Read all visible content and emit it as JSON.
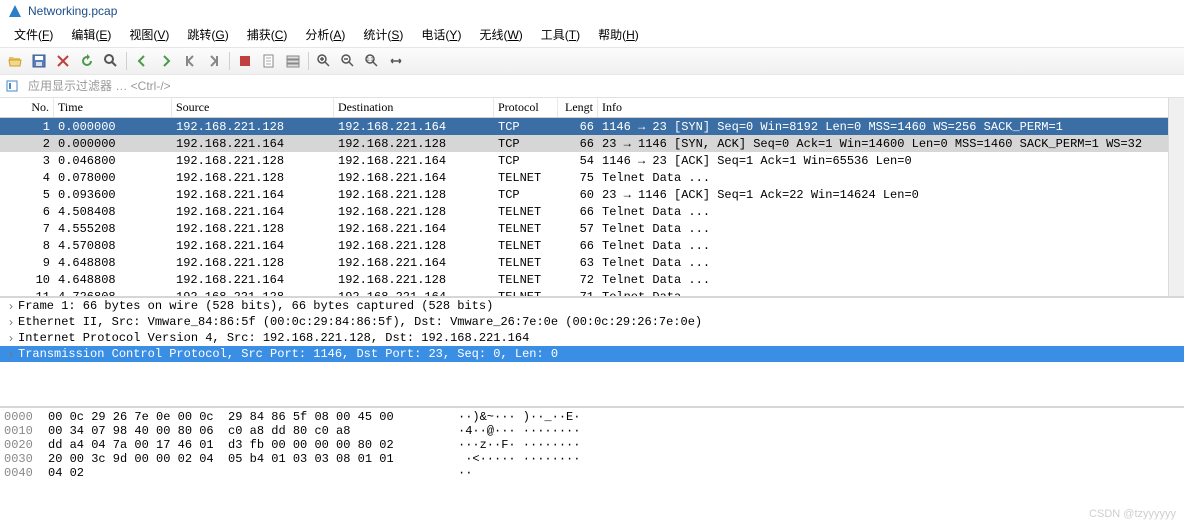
{
  "title": "Networking.pcap",
  "menu": [
    "文件(F)",
    "编辑(E)",
    "视图(V)",
    "跳转(G)",
    "捕获(C)",
    "分析(A)",
    "统计(S)",
    "电话(Y)",
    "无线(W)",
    "工具(T)",
    "帮助(H)"
  ],
  "filter_placeholder": "应用显示过滤器 … <Ctrl-/>",
  "columns": {
    "no": "No.",
    "time": "Time",
    "src": "Source",
    "dst": "Destination",
    "proto": "Protocol",
    "len": "Lengt",
    "info": "Info"
  },
  "packets": [
    {
      "no": "1",
      "time": "0.000000",
      "src": "192.168.221.128",
      "dst": "192.168.221.164",
      "proto": "TCP",
      "len": "66",
      "info": "1146 → 23 [SYN] Seq=0 Win=8192 Len=0 MSS=1460 WS=256 SACK_PERM=1",
      "sel": true
    },
    {
      "no": "2",
      "time": "0.000000",
      "src": "192.168.221.164",
      "dst": "192.168.221.128",
      "proto": "TCP",
      "len": "66",
      "info": "23 → 1146 [SYN, ACK] Seq=0 Ack=1 Win=14600 Len=0 MSS=1460 SACK_PERM=1 WS=32",
      "hl": true
    },
    {
      "no": "3",
      "time": "0.046800",
      "src": "192.168.221.128",
      "dst": "192.168.221.164",
      "proto": "TCP",
      "len": "54",
      "info": "1146 → 23 [ACK] Seq=1 Ack=1 Win=65536 Len=0"
    },
    {
      "no": "4",
      "time": "0.078000",
      "src": "192.168.221.128",
      "dst": "192.168.221.164",
      "proto": "TELNET",
      "len": "75",
      "info": "Telnet Data ..."
    },
    {
      "no": "5",
      "time": "0.093600",
      "src": "192.168.221.164",
      "dst": "192.168.221.128",
      "proto": "TCP",
      "len": "60",
      "info": "23 → 1146 [ACK] Seq=1 Ack=22 Win=14624 Len=0"
    },
    {
      "no": "6",
      "time": "4.508408",
      "src": "192.168.221.164",
      "dst": "192.168.221.128",
      "proto": "TELNET",
      "len": "66",
      "info": "Telnet Data ..."
    },
    {
      "no": "7",
      "time": "4.555208",
      "src": "192.168.221.128",
      "dst": "192.168.221.164",
      "proto": "TELNET",
      "len": "57",
      "info": "Telnet Data ..."
    },
    {
      "no": "8",
      "time": "4.570808",
      "src": "192.168.221.164",
      "dst": "192.168.221.128",
      "proto": "TELNET",
      "len": "66",
      "info": "Telnet Data ..."
    },
    {
      "no": "9",
      "time": "4.648808",
      "src": "192.168.221.128",
      "dst": "192.168.221.164",
      "proto": "TELNET",
      "len": "63",
      "info": "Telnet Data ..."
    },
    {
      "no": "10",
      "time": "4.648808",
      "src": "192.168.221.164",
      "dst": "192.168.221.128",
      "proto": "TELNET",
      "len": "72",
      "info": "Telnet Data ..."
    },
    {
      "no": "11",
      "time": "4.726808",
      "src": "192.168.221.128",
      "dst": "192.168.221.164",
      "proto": "TELNET",
      "len": "71",
      "info": "Telnet Data ..."
    }
  ],
  "details": [
    {
      "text": "Frame 1: 66 bytes on wire (528 bits), 66 bytes captured (528 bits)"
    },
    {
      "text": "Ethernet II, Src: Vmware_84:86:5f (00:0c:29:84:86:5f), Dst: Vmware_26:7e:0e (00:0c:29:26:7e:0e)"
    },
    {
      "text": "Internet Protocol Version 4, Src: 192.168.221.128, Dst: 192.168.221.164"
    },
    {
      "text": "Transmission Control Protocol, Src Port: 1146, Dst Port: 23, Seq: 0, Len: 0",
      "sel": true
    }
  ],
  "hex": [
    {
      "off": "0000",
      "b": "00 0c 29 26 7e 0e 00 0c  29 84 86 5f 08 00 45 00",
      "a": "··)&~··· )··_··E·"
    },
    {
      "off": "0010",
      "b": "00 34 07 98 40 00 80 06  c0 a8 dd 80 c0 a8",
      "a": "·4··@··· ········"
    },
    {
      "off": "0020",
      "b": "dd a4 04 7a 00 17 46 01  d3 fb 00 00 00 00 80 02",
      "a": "···z··F· ········"
    },
    {
      "off": "0030",
      "b": "20 00 3c 9d 00 00 02 04  05 b4 01 03 03 08 01 01",
      "a": " ·<····· ········"
    },
    {
      "off": "0040",
      "b": "04 02",
      "a": "··"
    }
  ],
  "watermark": "CSDN @tzyyyyyy",
  "toolbar_icons": [
    "folder-open-icon",
    "save-icon",
    "close-x-icon",
    "reload-icon",
    "find-icon",
    "sep",
    "back-arrow-icon",
    "forward-arrow-icon",
    "jump-start-icon",
    "jump-end-icon",
    "sep",
    "stop-square-icon",
    "document-icon",
    "stack-icon",
    "sep",
    "zoom-in-icon",
    "zoom-out-icon",
    "zoom-fit-icon",
    "resize-icon"
  ]
}
